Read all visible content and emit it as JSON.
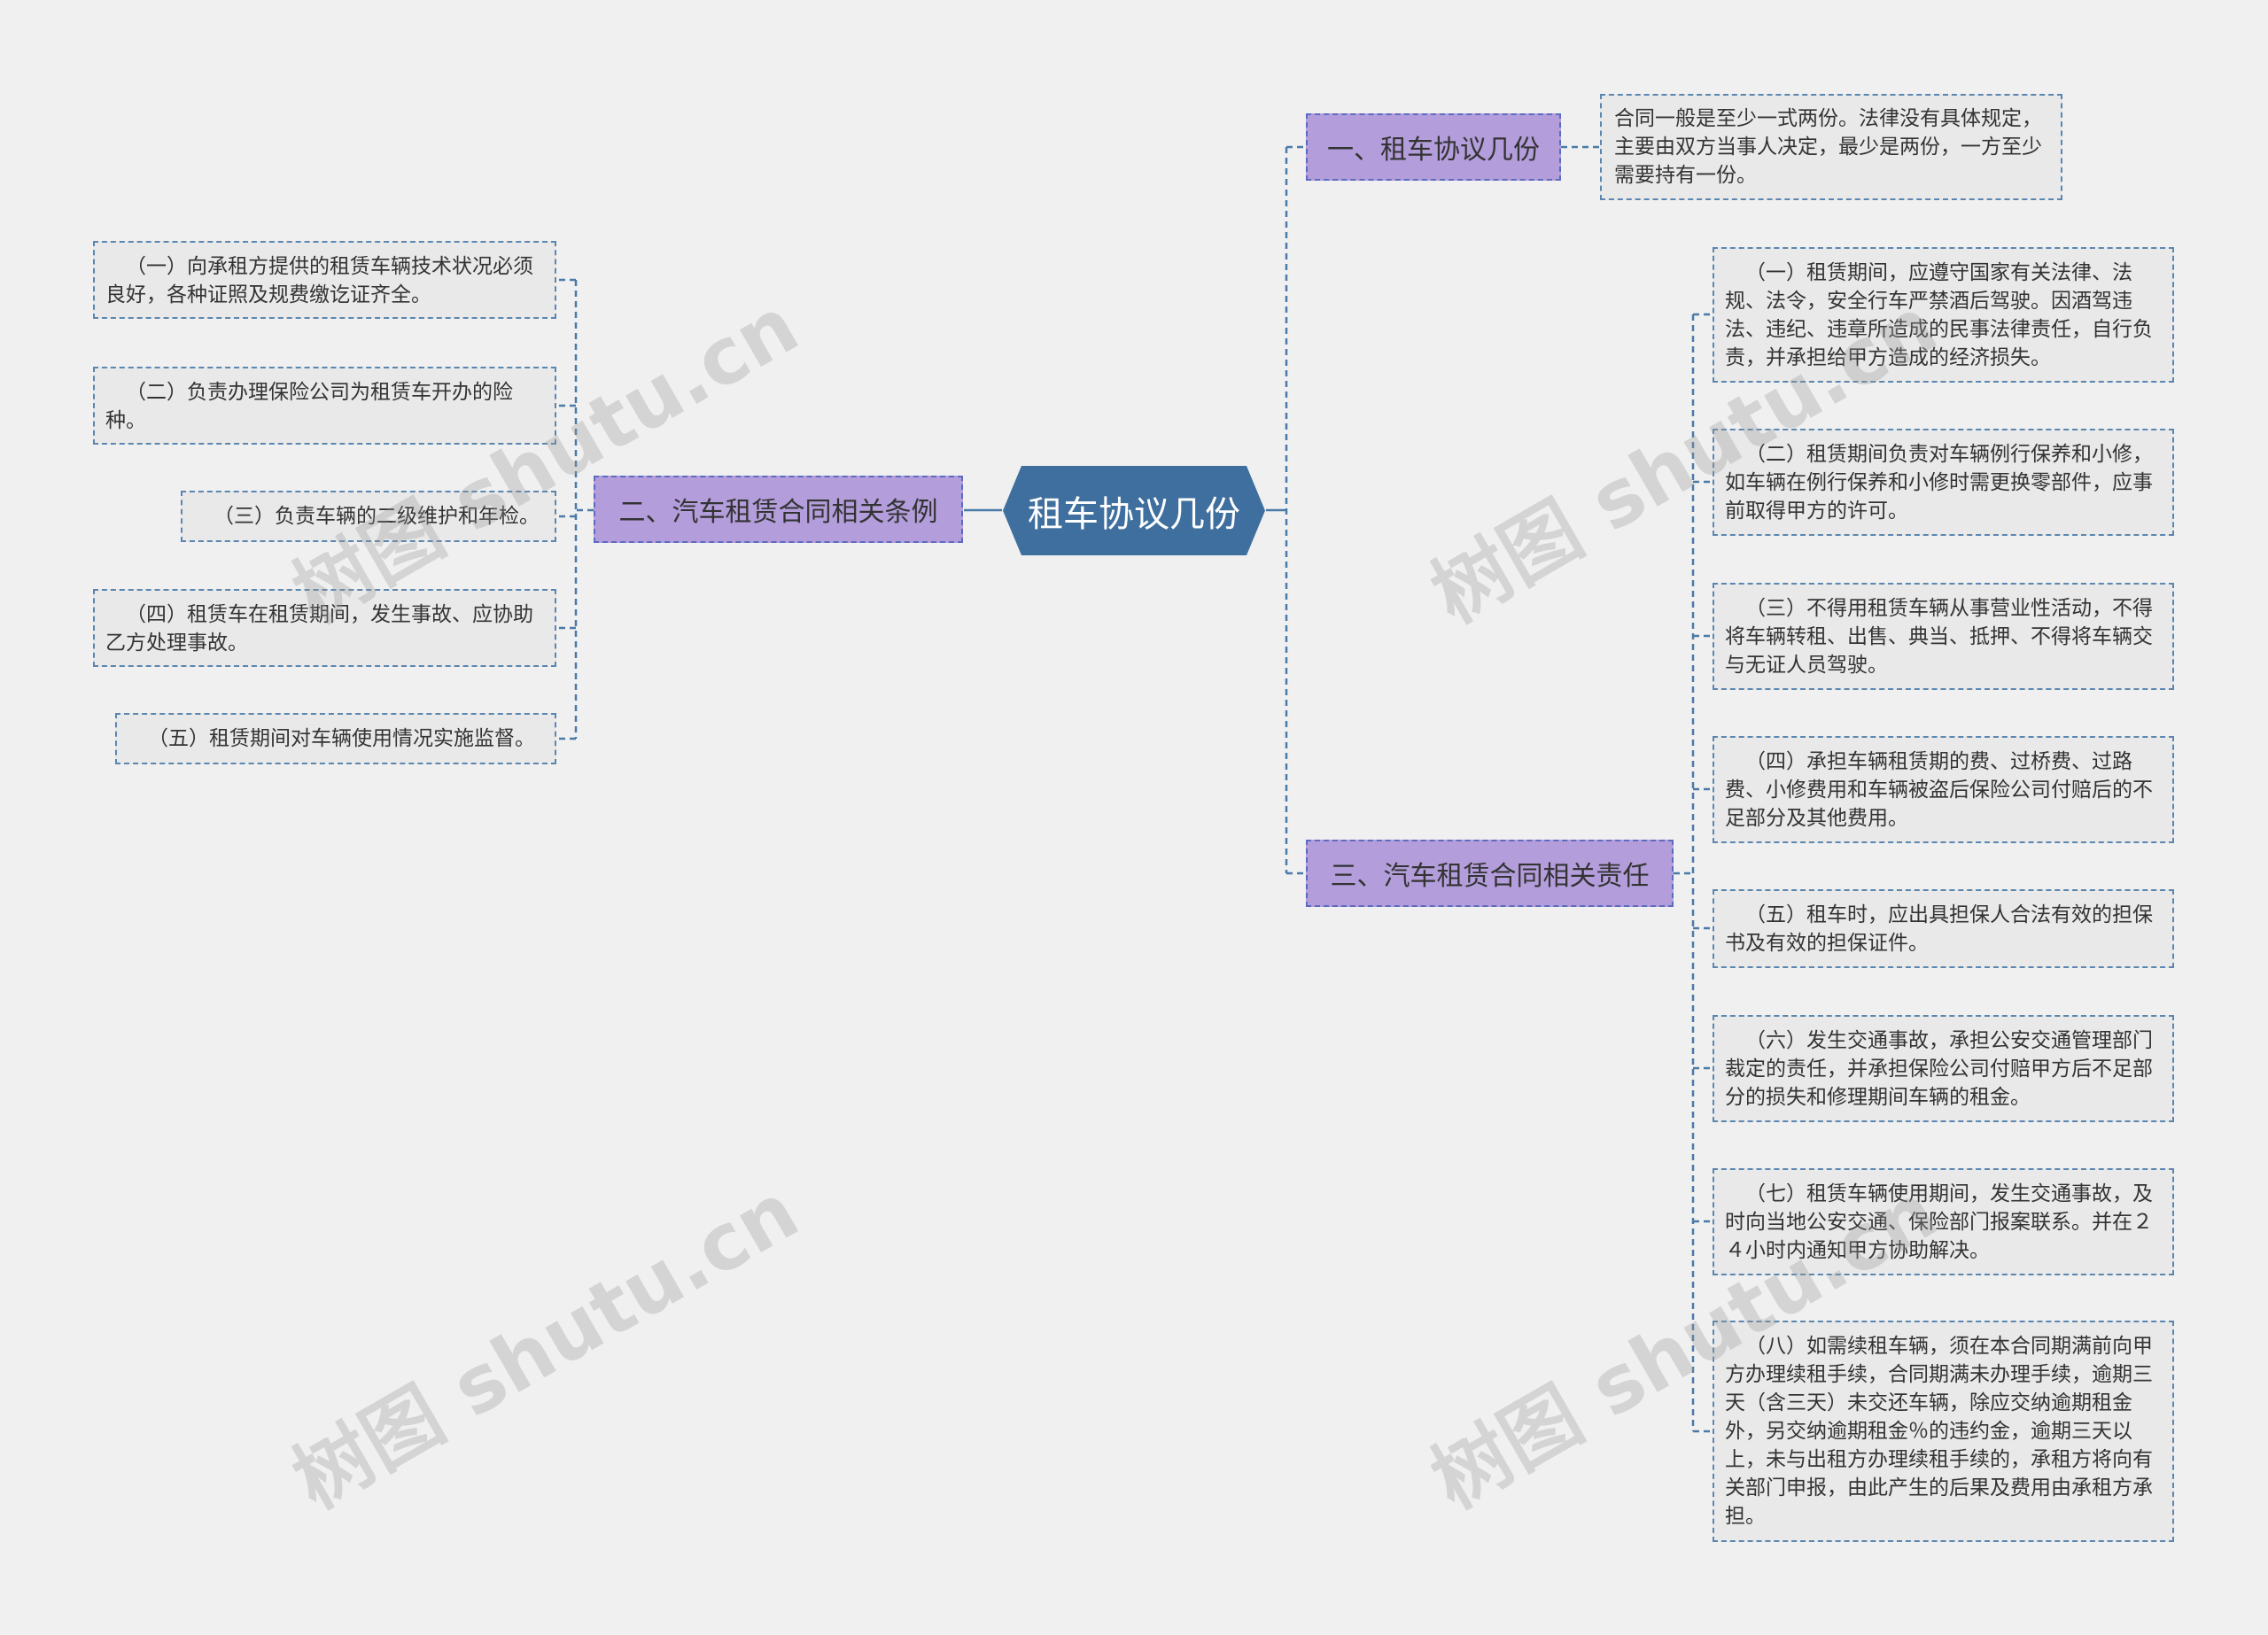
{
  "colors": {
    "background": "#f0f0f0",
    "center_fill": "#3f6f9e",
    "branch_fill": "#b39ddb",
    "leaf_fill": "#e9e9e9",
    "link": "#4a7aa8"
  },
  "root": {
    "label": "租车协议几份"
  },
  "branches": [
    {
      "label": "一、租车协议几份",
      "children": [
        "合同一般是至少一式两份。法律没有具体规定，主要由双方当事人决定，最少是两份，一方至少需要持有一份。"
      ]
    },
    {
      "label": "二、汽车租赁合同相关条例",
      "children": [
        "（一）向承租方提供的租赁车辆技术状况必须良好，各种证照及规费缴讫证齐全。",
        "（二）负责办理保险公司为租赁车开办的险种。",
        "（三）负责车辆的二级维护和年检。",
        "（四）租赁车在租赁期间，发生事故、应协助乙方处理事故。",
        "（五）租赁期间对车辆使用情况实施监督。"
      ]
    },
    {
      "label": "三、汽车租赁合同相关责任",
      "children": [
        "（一）租赁期间，应遵守国家有关法律、法规、法令，安全行车严禁酒后驾驶。因酒驾违法、违纪、违章所造成的民事法律责任，自行负责，并承担给甲方造成的经济损失。",
        "（二）租赁期间负责对车辆例行保养和小修，如车辆在例行保养和小修时需更换零部件，应事前取得甲方的许可。",
        "（三）不得用租赁车辆从事营业性活动，不得将车辆转租、出售、典当、抵押、不得将车辆交与无证人员驾驶。",
        "（四）承担车辆租赁期的费、过桥费、过路费、小修费用和车辆被盗后保险公司付赔后的不足部分及其他费用。",
        "（五）租车时，应出具担保人合法有效的担保书及有效的担保证件。",
        "（六）发生交通事故，承担公安交通管理部门裁定的责任，并承担保险公司付赔甲方后不足部分的损失和修理期间车辆的租金。",
        "（七）租赁车辆使用期间，发生交通事故，及时向当地公安交通、保险部门报案联系。并在２４小时内通知甲方协助解决。",
        "（八）如需续租车辆，须在本合同期满前向甲方办理续租手续，合同期满未办理手续，逾期三天（含三天）未交还车辆，除应交纳逾期租金外，另交纳逾期租金％的违约金，逾期三天以上，未与出租方办理续租手续的，承租方将向有关部门申报，由此产生的后果及费用由承租方承担。"
      ]
    }
  ],
  "watermark": "树图 shutu.cn"
}
